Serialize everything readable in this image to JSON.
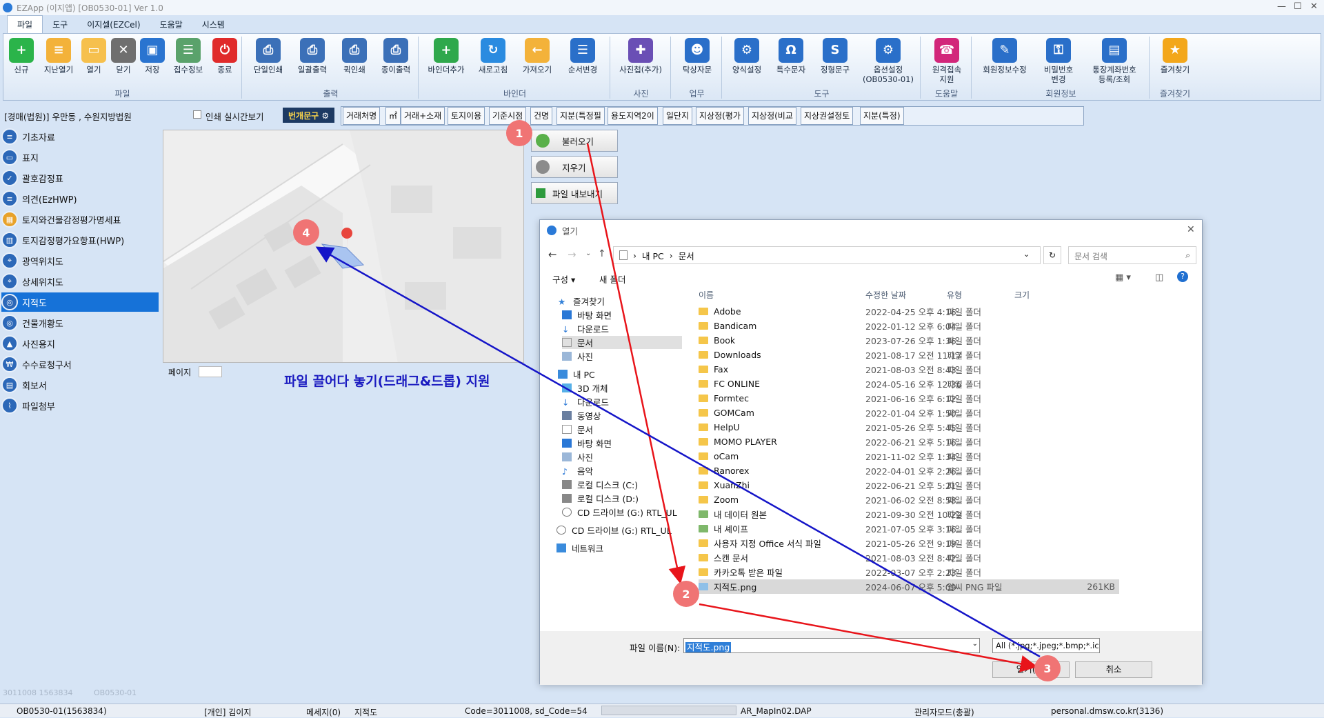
{
  "window": {
    "title": "EZApp (이지앱) [OB0530-01] Ver 1.0",
    "min": "—",
    "max": "☐",
    "close": "✕"
  },
  "menu_tabs": [
    "파일",
    "도구",
    "이지셀(EZCel)",
    "도움말",
    "시스템"
  ],
  "ribbon": {
    "groups": [
      {
        "label": "파일",
        "buttons": [
          "신규",
          "지난열기",
          "열기",
          "닫기",
          "저장",
          "접수정보",
          "종료"
        ]
      },
      {
        "label": "출력",
        "buttons": [
          "단일인쇄",
          "일괄출력",
          "퀵인쇄",
          "종이출력"
        ]
      },
      {
        "label": "바인더",
        "buttons": [
          "바인더추가",
          "새로고침",
          "가져오기",
          "순서변경"
        ]
      },
      {
        "label": "사진",
        "buttons": [
          "사진첩(추가)"
        ]
      },
      {
        "label": "업무",
        "buttons": [
          "탁상자문"
        ]
      },
      {
        "label": "도구",
        "buttons": [
          "양식설정",
          "특수문자",
          "정형문구",
          "옵션설정\n(OB0530-01)"
        ]
      },
      {
        "label": "도움말",
        "buttons": [
          "원격접속\n지원"
        ]
      },
      {
        "label": "회원정보",
        "buttons": [
          "회원정보수정",
          "비밀번호\n변경",
          "통장계좌번호\n등록/조회"
        ]
      },
      {
        "label": "즐겨찾기",
        "buttons": [
          "즐겨찾기"
        ]
      }
    ]
  },
  "case_title": "[경매(법원)] 우만동 , 수원지방법원",
  "print_realtime": "인쇄 실시간보기",
  "phrase_button": "번개문구",
  "keywords": [
    "거래처명",
    "㎡",
    "거래+소재",
    "토지이용",
    "기준시점",
    "건명",
    "지분(특정필",
    "용도지역2이",
    "일단지",
    "지상정(평가",
    "지상정(비교",
    "지상권설정토",
    "지분(특정)"
  ],
  "sidebar": [
    {
      "label": "기초자료"
    },
    {
      "label": "표지"
    },
    {
      "label": "괄호감정표"
    },
    {
      "label": "의견(EzHWP)"
    },
    {
      "label": "토지와건물감정평가명세표"
    },
    {
      "label": "토지감정평가요항표(HWP)"
    },
    {
      "label": "광역위치도"
    },
    {
      "label": "상세위치도"
    },
    {
      "label": "지적도"
    },
    {
      "label": "건물개황도"
    },
    {
      "label": "사진용지"
    },
    {
      "label": "수수료청구서"
    },
    {
      "label": "회보서"
    },
    {
      "label": "파일첨부"
    }
  ],
  "sidebar_footer": {
    "left": "3011008  1563834",
    "right": "OB0530-01"
  },
  "map_page_label": "페이지",
  "side_buttons": {
    "load": "불러오기",
    "erase": "지우기",
    "export": "파일 내보내기"
  },
  "drag_note": "파일 끌어다 놓기(드래그&드롭) 지원",
  "badges": [
    "1",
    "2",
    "3",
    "4"
  ],
  "dialog": {
    "title": "열기",
    "path": [
      "내 PC",
      "문서"
    ],
    "search_placeholder": "문서 검색",
    "organize": "구성 ▾",
    "new_folder": "새 폴더",
    "columns": {
      "name": "이름",
      "date": "수정한 날짜",
      "type": "유형",
      "size": "크기"
    },
    "nav": [
      "즐겨찾기",
      "바탕 화면",
      "다운로드",
      "문서",
      "사진",
      "내 PC",
      "3D 개체",
      "다운로드",
      "동영상",
      "문서",
      "바탕 화면",
      "사진",
      "음악",
      "로컬 디스크 (C:)",
      "로컬 디스크 (D:)",
      "CD 드라이브 (G:) RTL_UL",
      "CD 드라이브 (G:) RTL_UL",
      "네트워크"
    ],
    "files": [
      {
        "name": "Adobe",
        "date": "2022-04-25 오후 4:16",
        "type": "파일 폴더",
        "size": ""
      },
      {
        "name": "Bandicam",
        "date": "2022-01-12 오후 6:04",
        "type": "파일 폴더",
        "size": ""
      },
      {
        "name": "Book",
        "date": "2023-07-26 오후 1:36",
        "type": "파일 폴더",
        "size": ""
      },
      {
        "name": "Downloads",
        "date": "2021-08-17 오전 11:17",
        "type": "파일 폴더",
        "size": ""
      },
      {
        "name": "Fax",
        "date": "2021-08-03 오전 8:43",
        "type": "파일 폴더",
        "size": ""
      },
      {
        "name": "FC ONLINE",
        "date": "2024-05-16 오후 12:36",
        "type": "파일 폴더",
        "size": ""
      },
      {
        "name": "Formtec",
        "date": "2021-06-16 오후 6:12",
        "type": "파일 폴더",
        "size": ""
      },
      {
        "name": "GOMCam",
        "date": "2022-01-04 오후 1:50",
        "type": "파일 폴더",
        "size": ""
      },
      {
        "name": "HelpU",
        "date": "2021-05-26 오후 5:45",
        "type": "파일 폴더",
        "size": ""
      },
      {
        "name": "MOMO PLAYER",
        "date": "2022-06-21 오후 5:16",
        "type": "파일 폴더",
        "size": ""
      },
      {
        "name": "oCam",
        "date": "2021-11-02 오후 1:34",
        "type": "파일 폴더",
        "size": ""
      },
      {
        "name": "Ranorex",
        "date": "2022-04-01 오후 2:26",
        "type": "파일 폴더",
        "size": ""
      },
      {
        "name": "XuanZhi",
        "date": "2022-06-21 오후 5:21",
        "type": "파일 폴더",
        "size": ""
      },
      {
        "name": "Zoom",
        "date": "2021-06-02 오전 8:58",
        "type": "파일 폴더",
        "size": ""
      },
      {
        "name": "내 데이터 원본",
        "date": "2021-09-30 오전 10:22",
        "type": "파일 폴더",
        "size": ""
      },
      {
        "name": "내 셰이프",
        "date": "2021-07-05 오후 3:16",
        "type": "파일 폴더",
        "size": ""
      },
      {
        "name": "사용자 지정 Office 서식 파일",
        "date": "2021-05-26 오전 9:19",
        "type": "파일 폴더",
        "size": ""
      },
      {
        "name": "스캔 문서",
        "date": "2021-08-03 오전 8:42",
        "type": "파일 폴더",
        "size": ""
      },
      {
        "name": "카카오톡 받은 파일",
        "date": "2022-03-07 오후 2:23",
        "type": "파일 폴더",
        "size": ""
      },
      {
        "name": "지적도.png",
        "date": "2024-06-07 오후 5:09",
        "type": "알씨 PNG 파일",
        "size": "261KB"
      }
    ],
    "filename_label": "파일 이름(N):",
    "filename_value": "지적도.png",
    "filter": "All (*.jpg;*.jpeg;*.bmp;*.ico;*.e",
    "open": "열기(O)",
    "cancel": "취소"
  },
  "status": {
    "code": "OB0530-01(1563834)",
    "user": "[개인] 김이지",
    "msg": "메세지(0)",
    "page": "지적도",
    "codes": "Code=3011008, sd_Code=54",
    "file": "AR_MapIn02.DAP",
    "mode": "관리자모드(총괄)",
    "site": "personal.dmsw.co.kr(3136)"
  },
  "colors": {
    "accent": "#1672d8",
    "badge": "#f07474",
    "red_arrow": "#e8141a",
    "blue_arrow": "#1515c8"
  }
}
